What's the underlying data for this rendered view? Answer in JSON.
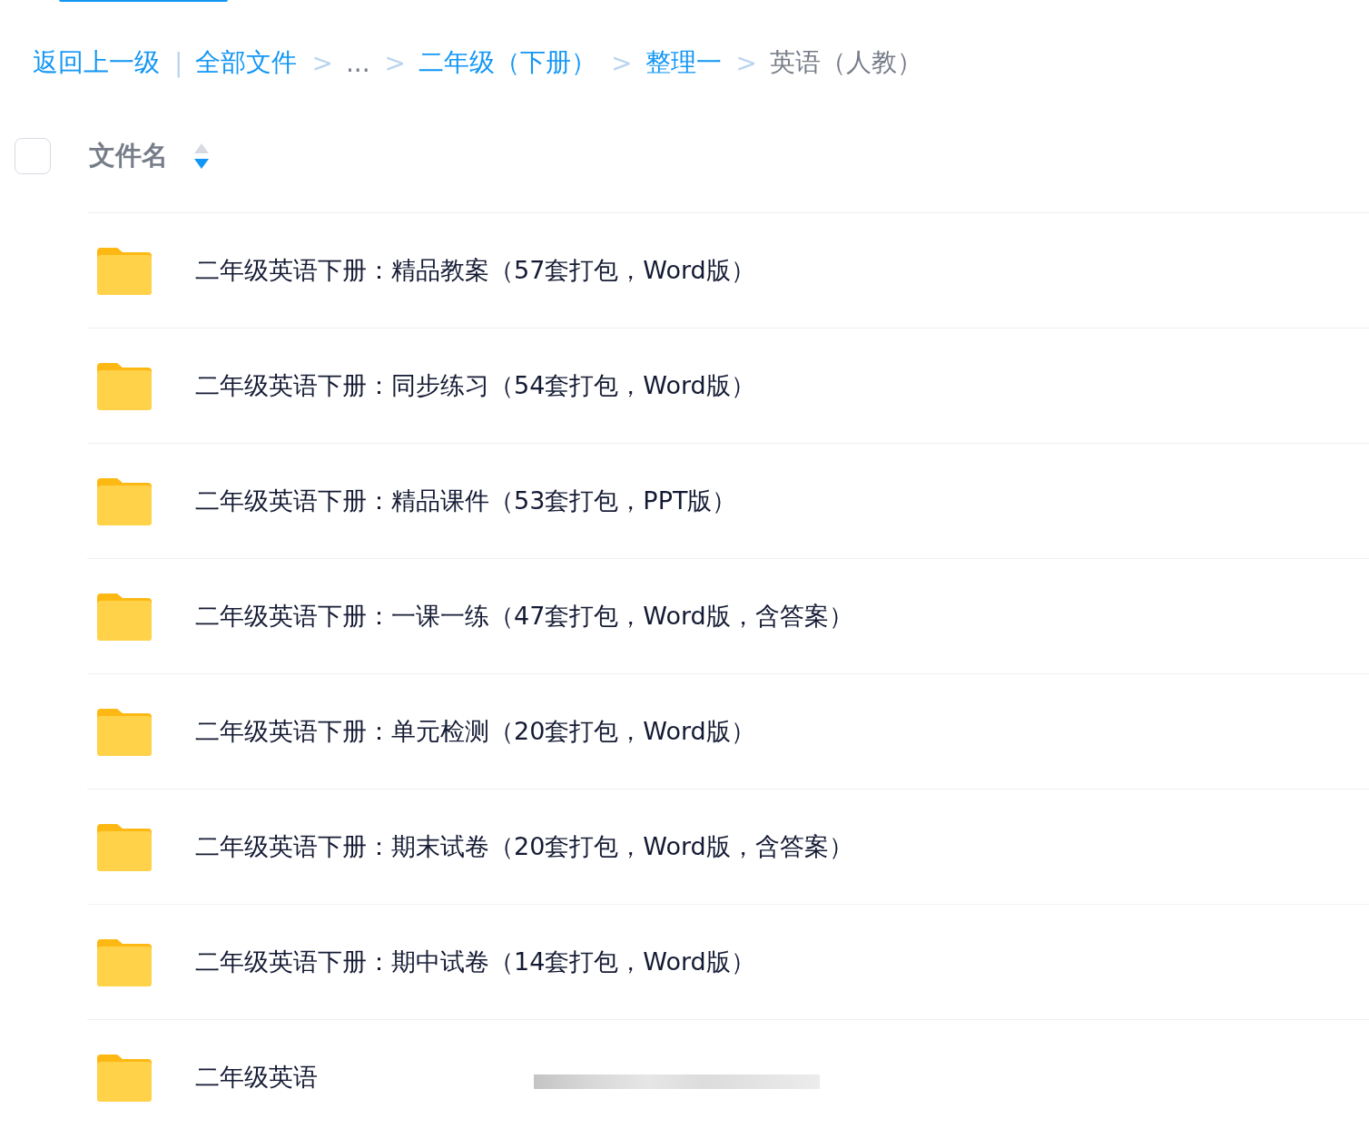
{
  "breadcrumb": [
    {
      "kind": "link",
      "label": "返回上一级"
    },
    {
      "kind": "separator",
      "label": "|"
    },
    {
      "kind": "link",
      "label": "全部文件"
    },
    {
      "kind": "separator",
      "label": ">"
    },
    {
      "kind": "ellipsis",
      "label": "..."
    },
    {
      "kind": "separator",
      "label": ">"
    },
    {
      "kind": "link",
      "label": "二年级（下册）"
    },
    {
      "kind": "separator",
      "label": ">"
    },
    {
      "kind": "link",
      "label": "整理一"
    },
    {
      "kind": "separator",
      "label": ">"
    },
    {
      "kind": "current",
      "label": "英语（人教）"
    }
  ],
  "header": {
    "select_all": {
      "checked": false
    },
    "column": "文件名",
    "sort_descending": true
  },
  "files": [
    {
      "name": "二年级英语下册：精品教案（57套打包，Word版）"
    },
    {
      "name": "二年级英语下册：同步练习（54套打包，Word版）"
    },
    {
      "name": "二年级英语下册：精品课件（53套打包，PPT版）"
    },
    {
      "name": "二年级英语下册：一课一练（47套打包，Word版，含答案）"
    },
    {
      "name": "二年级英语下册：单元检测（20套打包，Word版）"
    },
    {
      "name": "二年级英语下册：期末试卷（20套打包，Word版，含答案）"
    },
    {
      "name": "二年级英语下册：期中试卷（14套打包，Word版）"
    },
    {
      "name": "二年级英语",
      "redacted": true
    }
  ]
}
